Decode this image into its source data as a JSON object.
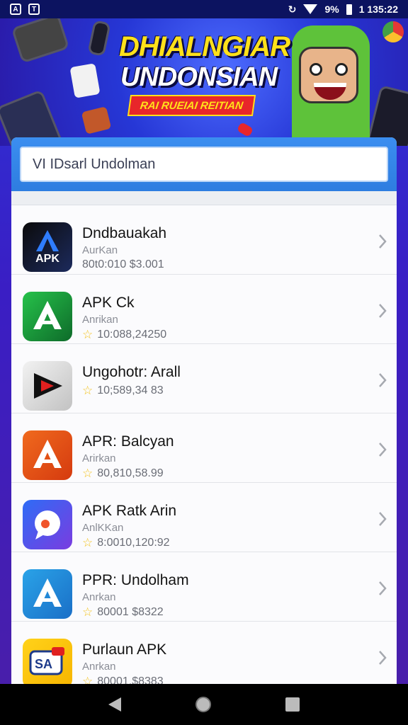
{
  "status_bar": {
    "left_icons": [
      "A",
      "T"
    ],
    "signal_icon": "wifi-icon",
    "battery": "9%",
    "time": "1 135:22"
  },
  "banner": {
    "title_line1": "DHIALNGIAR",
    "title_line2": "UNDONSIAN",
    "ribbon": "RAI RUEIAI REITIAN"
  },
  "search": {
    "value": "VI IDsarl Undolman"
  },
  "apps": [
    {
      "name": "Dndbauakah",
      "developer": "AurKan",
      "meta": "80t0:010 $3.001",
      "star": false,
      "icon": "apk-black-icon",
      "colors": [
        "#0b0b0b",
        "#1c2a5c"
      ]
    },
    {
      "name": "APK Ck",
      "developer": "Anrikan",
      "meta": "10:088,24250",
      "star": true,
      "icon": "apk-green-icon",
      "colors": [
        "#26c24a",
        "#0e6b2a"
      ]
    },
    {
      "name": "Ungohotr: Arall",
      "developer": "",
      "meta": "10;589,34 83",
      "star": true,
      "icon": "play-triangle-icon",
      "colors": [
        "#f2f2f2",
        "#c2c2c2"
      ]
    },
    {
      "name": "APR: Balcyan",
      "developer": "Arirkan",
      "meta": "80,810,58.99",
      "star": true,
      "icon": "apk-orange-icon",
      "colors": [
        "#f06a1e",
        "#d53a0f"
      ]
    },
    {
      "name": "APK Ratk Arin",
      "developer": "AnlKKan",
      "meta": "8:0010,120:92",
      "star": true,
      "icon": "chat-bubble-icon",
      "colors": [
        "#2e6cf6",
        "#7a3ce0"
      ]
    },
    {
      "name": "PPR: Undolham",
      "developer": "Anrkan",
      "meta": "80001 $8322",
      "star": true,
      "icon": "apk-blue-icon",
      "colors": [
        "#2aa3e8",
        "#1a6fc7"
      ]
    },
    {
      "name": "Purlaun APK",
      "developer": "Anrkan",
      "meta": "80001,$8383",
      "star": true,
      "icon": "sa-yellow-icon",
      "colors": [
        "#ffd21a",
        "#f7b500"
      ]
    }
  ],
  "icon_labels": {
    "apk_text": "APK",
    "sa_text": "SA"
  },
  "nav": {
    "back": "back-icon",
    "home": "home-icon",
    "recent": "recents-icon"
  }
}
